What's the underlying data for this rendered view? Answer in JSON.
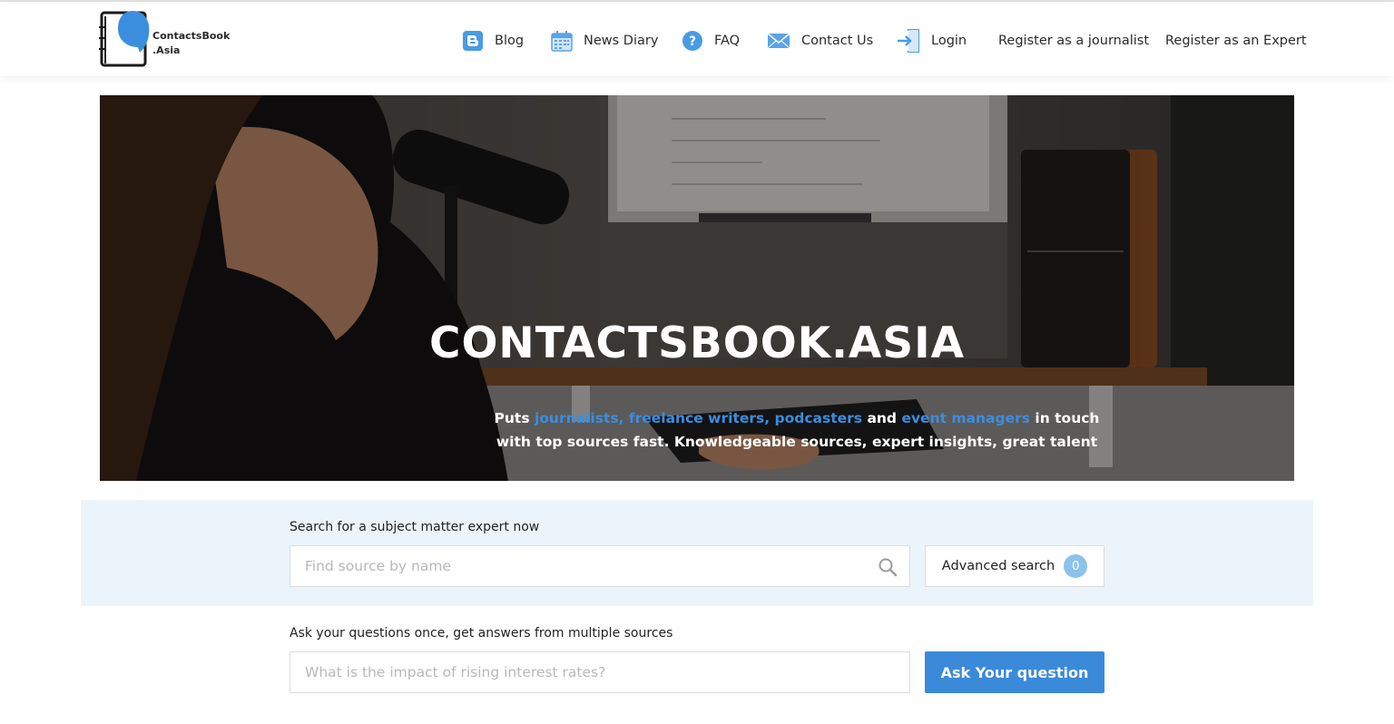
{
  "brand": {
    "line1": "ContactsBook",
    "line2": ".Asia"
  },
  "nav": {
    "items": [
      {
        "label": "Blog",
        "icon": "blogger-icon"
      },
      {
        "label": "News Diary",
        "icon": "calendar-icon"
      },
      {
        "label": "FAQ",
        "icon": "question-icon"
      },
      {
        "label": "Contact Us",
        "icon": "envelope-icon"
      },
      {
        "label": "Login",
        "icon": "login-icon"
      },
      {
        "label": "Register as a journalist"
      },
      {
        "label": "Register as an Expert"
      }
    ]
  },
  "hero": {
    "title": "CONTACTSBOOK.ASIA",
    "sub": {
      "puts": "Puts ",
      "link1": "journalists, freelance writers, podcasters",
      "and": " and ",
      "link2": "event managers",
      "rest": " in touch with top sources fast. Knowledgeable sources, expert insights, great talent"
    }
  },
  "search": {
    "label": "Search for a subject matter expert now",
    "placeholder": "Find source by name",
    "advanced_label": "Advanced search",
    "advanced_count": "0"
  },
  "ask": {
    "label": "Ask your questions once, get answers from multiple sources",
    "placeholder": "What is the impact of rising interest rates?",
    "button": "Ask Your question"
  },
  "colors": {
    "accent": "#3a8ad9",
    "band": "#ecf4fb",
    "badge": "#8cc1ea"
  }
}
